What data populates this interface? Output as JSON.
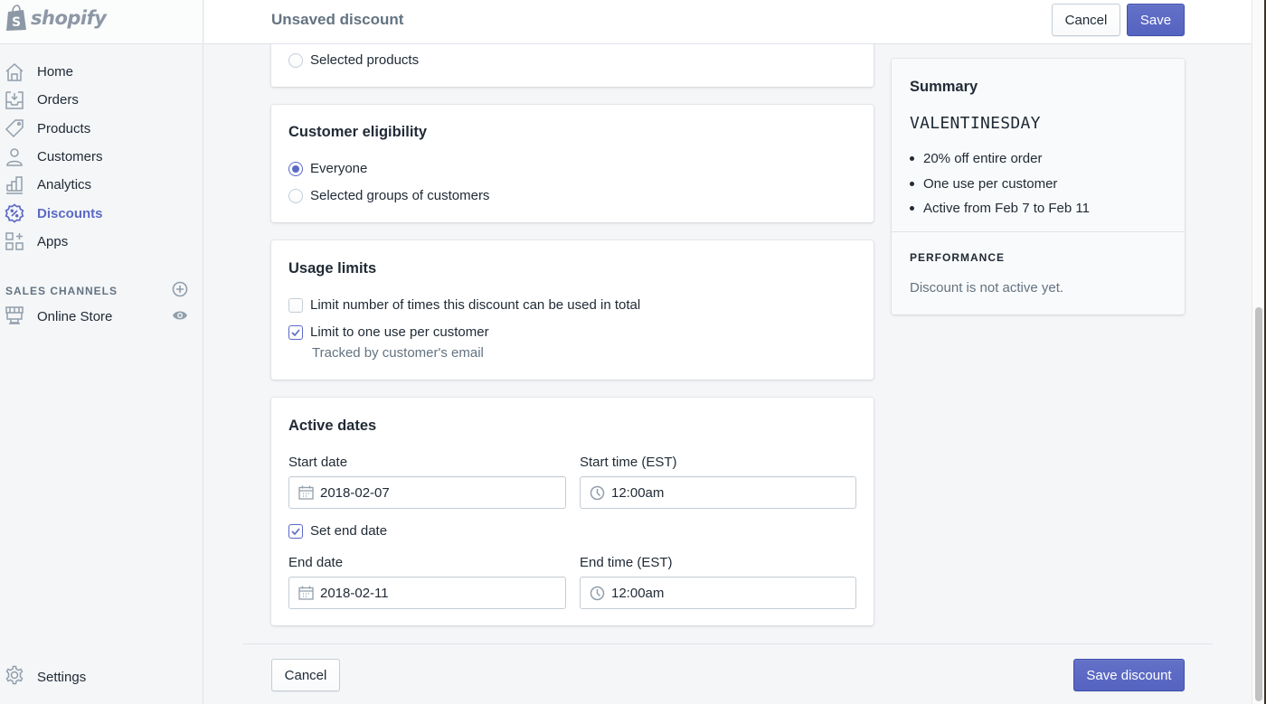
{
  "brand": {
    "name": "shopify",
    "logo_icon": "shopify-bag-icon"
  },
  "sidebar": {
    "items": [
      {
        "label": "Home",
        "icon": "home-icon",
        "active": false
      },
      {
        "label": "Orders",
        "icon": "orders-inbox-icon",
        "active": false
      },
      {
        "label": "Products",
        "icon": "tag-icon",
        "active": false
      },
      {
        "label": "Customers",
        "icon": "person-icon",
        "active": false
      },
      {
        "label": "Analytics",
        "icon": "bar-chart-icon",
        "active": false
      },
      {
        "label": "Discounts",
        "icon": "discount-badge-icon",
        "active": true
      },
      {
        "label": "Apps",
        "icon": "apps-grid-icon",
        "active": false
      }
    ],
    "sales_channels": {
      "heading": "SALES CHANNELS",
      "add_icon": "plus-circle-icon",
      "items": [
        {
          "label": "Online Store",
          "icon": "store-icon",
          "action_icon": "eye-icon"
        }
      ]
    },
    "settings": {
      "label": "Settings",
      "icon": "gear-icon"
    }
  },
  "topbar": {
    "title": "Unsaved discount",
    "cancel_label": "Cancel",
    "save_label": "Save"
  },
  "applies_to": {
    "options": [
      {
        "label": "Selected products",
        "checked": false
      }
    ]
  },
  "customer_eligibility": {
    "title": "Customer eligibility",
    "options": [
      {
        "label": "Everyone",
        "checked": true
      },
      {
        "label": "Selected groups of customers",
        "checked": false
      }
    ]
  },
  "usage_limits": {
    "title": "Usage limits",
    "options": [
      {
        "label": "Limit number of times this discount can be used in total",
        "checked": false
      },
      {
        "label": "Limit to one use per customer",
        "checked": true,
        "help": "Tracked by customer's email"
      }
    ]
  },
  "active_dates": {
    "title": "Active dates",
    "start_date": {
      "label": "Start date",
      "value": "2018-02-07",
      "icon": "calendar-icon"
    },
    "start_time": {
      "label": "Start time (EST)",
      "value": "12:00am",
      "icon": "clock-icon"
    },
    "set_end_date": {
      "label": "Set end date",
      "checked": true
    },
    "end_date": {
      "label": "End date",
      "value": "2018-02-11",
      "icon": "calendar-icon"
    },
    "end_time": {
      "label": "End time (EST)",
      "value": "12:00am",
      "icon": "clock-icon"
    }
  },
  "summary": {
    "title": "Summary",
    "code": "VALENTINESDAY",
    "bullets": [
      "20% off entire order",
      "One use per customer",
      "Active from Feb 7 to Feb 11"
    ],
    "performance_heading": "PERFORMANCE",
    "performance_text": "Discount is not active yet."
  },
  "footer": {
    "cancel_label": "Cancel",
    "save_label": "Save discount"
  },
  "colors": {
    "accent": "#5c6ac4",
    "text": "#212b36",
    "subdued": "#637381",
    "background": "#f4f6f8",
    "icon": "#919eab"
  }
}
